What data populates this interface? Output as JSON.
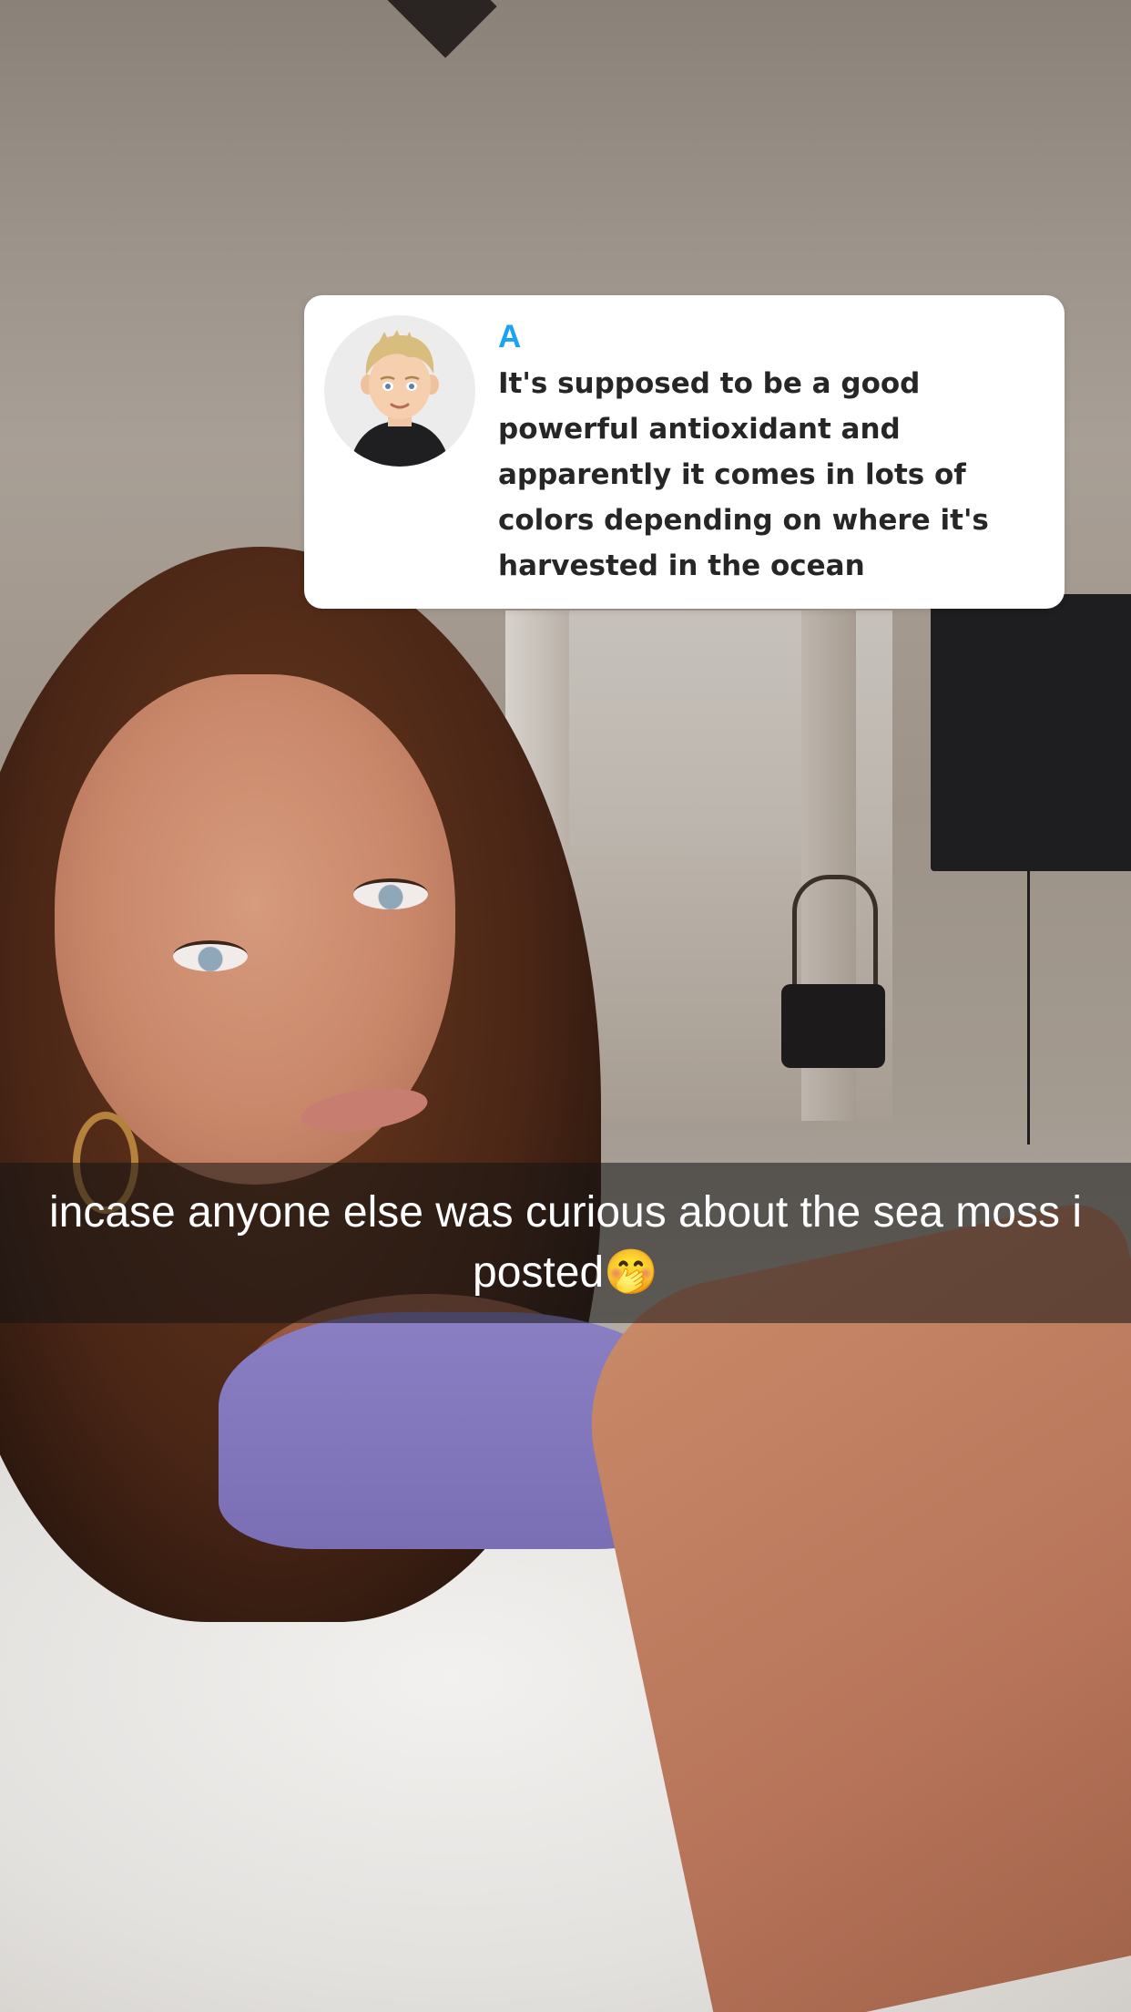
{
  "reply_sticker": {
    "sender": "A",
    "message": "It's supposed to be a good powerful antioxidant and apparently it comes in lots of colors depending on where it's harvested in the ocean",
    "sender_color": "#1aa3f0",
    "avatar_icon": "bitmoji-avatar-icon"
  },
  "caption": {
    "text": "incase anyone else was curious about the sea moss i posted🤭"
  }
}
